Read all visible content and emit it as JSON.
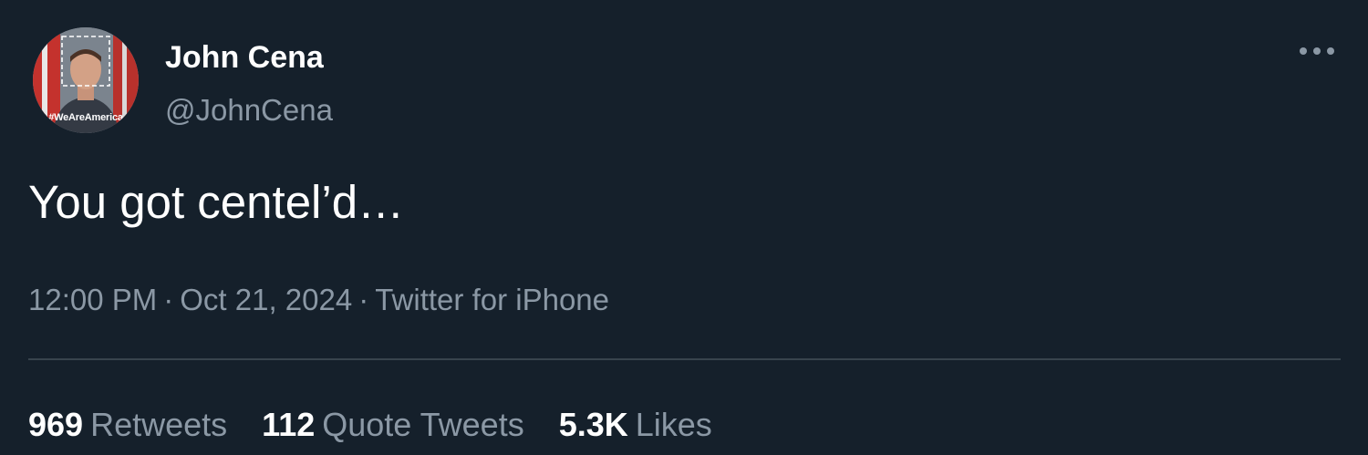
{
  "author": {
    "display_name": "John Cena",
    "handle": "@JohnCena",
    "avatar_tag": "#WeAreAmerica"
  },
  "tweet": {
    "text": "You got centel’d…",
    "time": "12:00 PM",
    "separator": "·",
    "date": "Oct 21, 2024",
    "source": "Twitter for iPhone"
  },
  "stats": {
    "retweets": {
      "count": "969",
      "label": "Retweets"
    },
    "quote_tweets": {
      "count": "112",
      "label": "Quote Tweets"
    },
    "likes": {
      "count": "5.3K",
      "label": "Likes"
    }
  },
  "icons": {
    "more": "more-horizontal-icon"
  },
  "colors": {
    "background": "#15202b",
    "primary_text": "#ffffff",
    "secondary_text": "#8b98a5",
    "divider": "#38444d"
  }
}
